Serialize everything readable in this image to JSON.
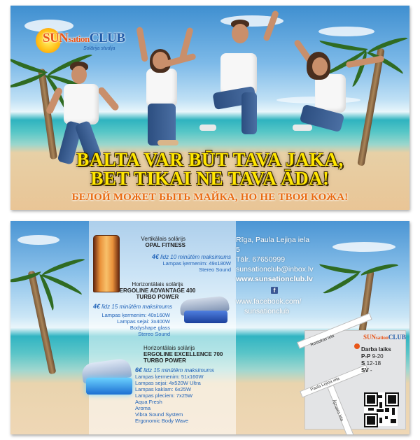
{
  "logo": {
    "brand_a": "SUN",
    "brand_b": "sation",
    "brand_c": "CLUB",
    "tagline": "Solārija studija"
  },
  "front": {
    "headline_line1": "BALTA VAR BŪT TAVA JAKA,",
    "headline_line2": "BET TIKAI NE TAVA ĀDA!",
    "headline_ru": "БЕЛОЙ МОЖЕТ БЫТЬ МАЙКА, НО НЕ ТВОЯ КОЖА!"
  },
  "solariums": [
    {
      "type": "Vertikālais solārijs",
      "name": "OPAL FITNESS",
      "price": "4€",
      "price_note": "līdz 10 minūtēm maksimums",
      "specs": [
        "Lampas ķermenim: 49x180W",
        "Stereo Sound"
      ]
    },
    {
      "type": "Horizontālais solārijs",
      "name": "ERGOLINE ADVANTAGE 400 TURBO POWER",
      "name_l1": "ERGOLINE ADVANTAGE 400",
      "name_l2": "TURBO POWER",
      "price": "4€",
      "price_note": "līdz 15 minūtēm maksimums",
      "specs": [
        "Lampas ķermenim: 40x160W",
        "Lampas sejai: 3x400W",
        "Bodyshape glass",
        "Stereo Sound"
      ]
    },
    {
      "type": "Horizontālais solārijs",
      "name": "ERGOLINE EXCELLENCE 700 TURBO POWER",
      "name_l1": "ERGOLINE EXCELLENCE 700",
      "name_l2": "TURBO POWER",
      "price": "6€",
      "price_note": "līdz 15 minūtēm maksimums",
      "specs": [
        "Lampas ķermenim: 51x160W",
        "Lampas sejai: 4x520W Ultra",
        "Lampas kaklam: 6x25W",
        "Lampas pleciem: 7x25W",
        "Aqua Fresh",
        "Aroma",
        "Vibra Sound System",
        "Ergonomic Body Wave"
      ]
    }
  ],
  "contact": {
    "address": "Rīga, Paula Lejiņa iela 5",
    "phone": "Tālr. 67650999",
    "email": "sunsationclub@inbox.lv",
    "website": "www.sunsationclub.lv",
    "facebook_l1": "www.facebook.com/",
    "facebook_l2": "sunsationclub"
  },
  "map": {
    "street1": "Rostokas iela",
    "street2": "Paula Lejiņa iela",
    "street3": "Ājzupes iela",
    "hours_title": "Darba laiks",
    "hours": [
      {
        "days": "P-P",
        "time": "9-20"
      },
      {
        "days": "S",
        "time": "12-18"
      },
      {
        "days": "SV",
        "time": "-"
      }
    ]
  },
  "colors": {
    "headline": "#ffe600",
    "headline_ru": "#e86a10",
    "brand_orange": "#e8561a",
    "brand_blue": "#1f5aa8",
    "accent_blue": "#1f62b8"
  }
}
